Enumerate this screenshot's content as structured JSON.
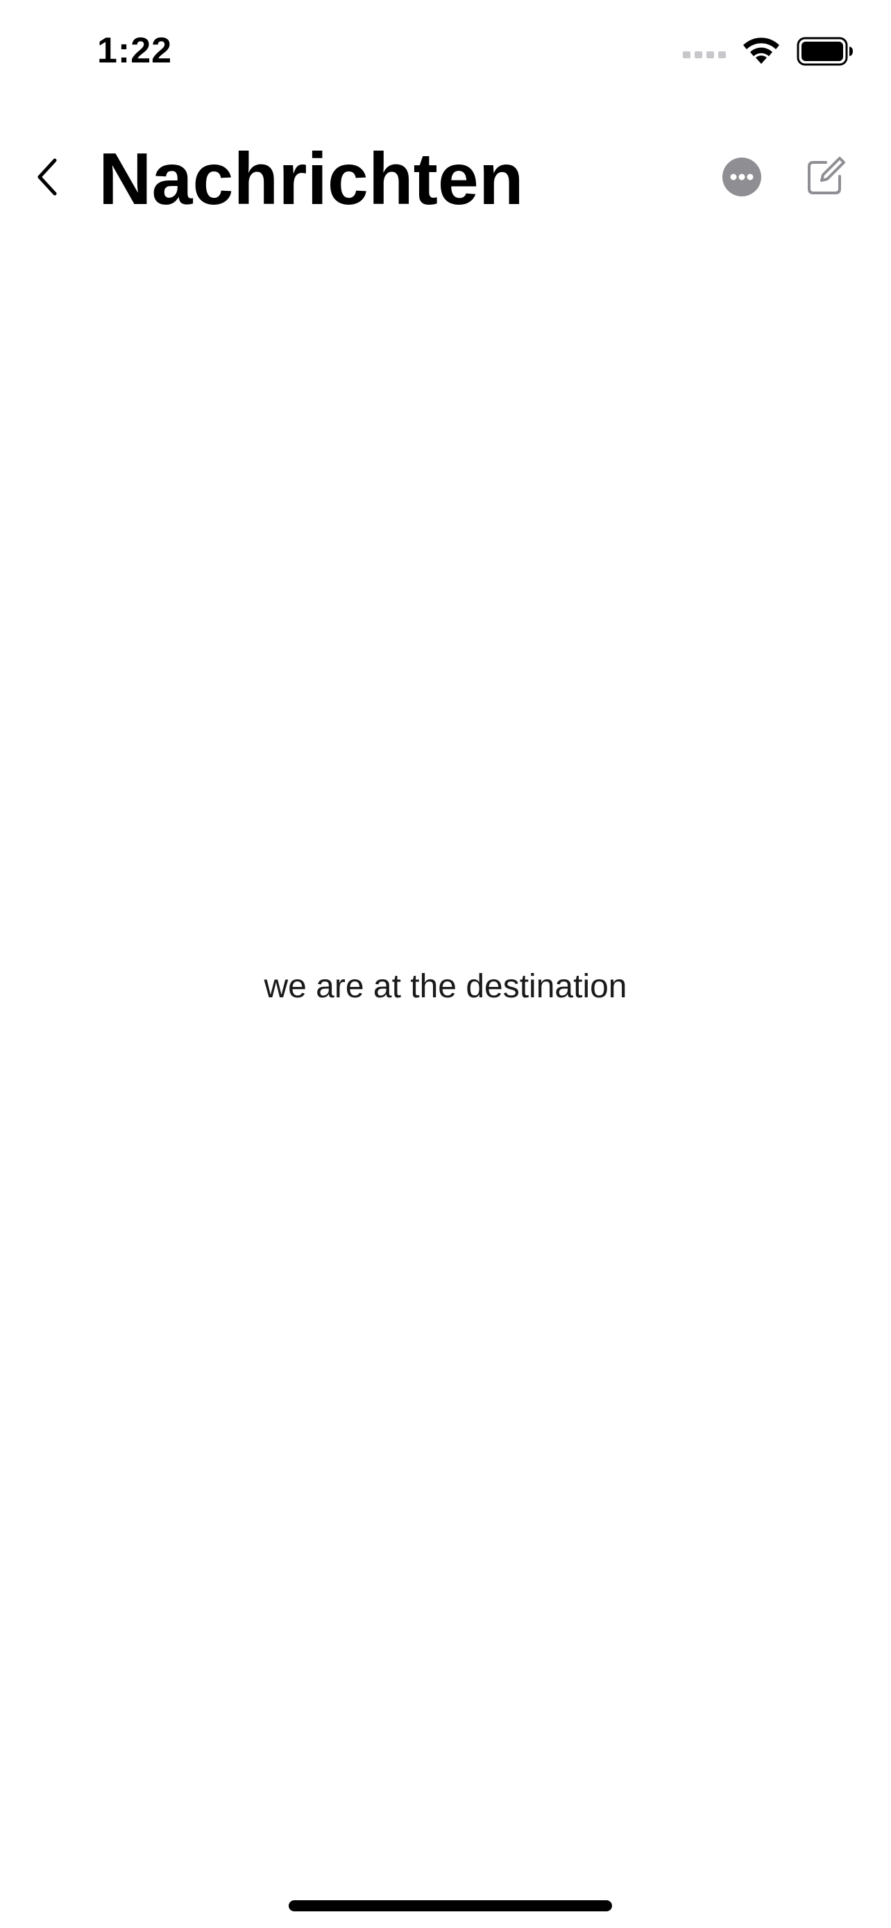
{
  "status_bar": {
    "time": "1:22",
    "icons": [
      "cellular-signal-icon",
      "wifi-icon",
      "battery-icon"
    ]
  },
  "nav": {
    "back_icon": "chevron-left-icon",
    "title": "Nachrichten",
    "actions": [
      {
        "icon": "more-circle-icon",
        "color": "#8e8e93"
      },
      {
        "icon": "compose-icon",
        "color": "#8e8e93"
      }
    ]
  },
  "content": {
    "empty_message": "we are at the destination"
  },
  "colors": {
    "background": "#ffffff",
    "text": "#000000",
    "icon_gray": "#8e8e93"
  }
}
